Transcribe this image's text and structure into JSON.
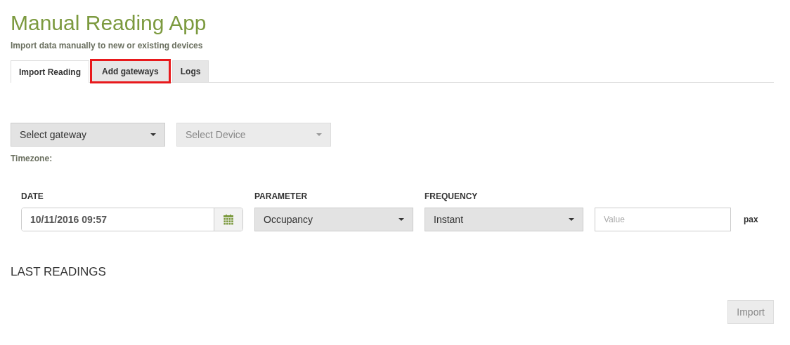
{
  "header": {
    "title": "Manual Reading App",
    "subtitle": "Import data manually to new or existing devices"
  },
  "tabs": [
    {
      "label": "Import Reading",
      "selected": true,
      "highlighted": false
    },
    {
      "label": "Add gateways",
      "selected": false,
      "highlighted": true
    },
    {
      "label": "Logs",
      "selected": false,
      "highlighted": false
    }
  ],
  "selectors": [
    {
      "value": "Select gateway",
      "disabled": false
    },
    {
      "value": "Select Device",
      "disabled": true
    }
  ],
  "timezone_label": "Timezone:",
  "reading_form": {
    "date": {
      "label": "DATE",
      "value": "10/11/2016 09:57"
    },
    "parameter": {
      "label": "PARAMETER",
      "value": "Occupancy"
    },
    "frequency": {
      "label": "FREQUENCY",
      "value": "Instant"
    },
    "value": {
      "placeholder": "Value"
    },
    "unit": "pax"
  },
  "last_readings": {
    "title": "LAST READINGS"
  },
  "import_button": {
    "label": "Import",
    "disabled": true
  }
}
